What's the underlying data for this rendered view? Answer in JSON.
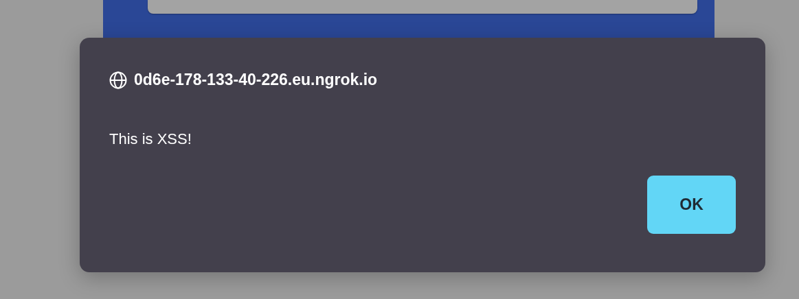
{
  "dialog": {
    "origin": "0d6e-178-133-40-226.eu.ngrok.io",
    "message": "This is XSS!",
    "buttons": [
      "OK"
    ]
  }
}
